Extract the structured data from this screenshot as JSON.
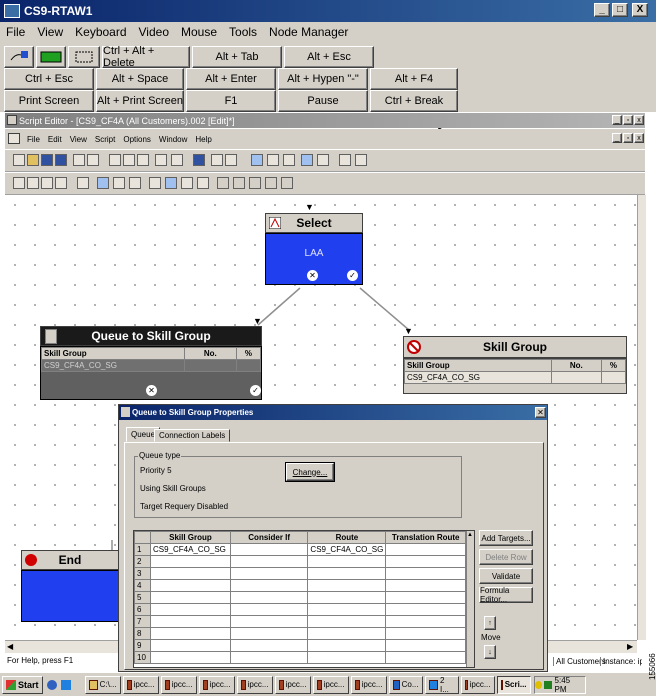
{
  "outer_window": {
    "title": "CS9-RTAW1",
    "menu": [
      "File",
      "View",
      "Keyboard",
      "Video",
      "Mouse",
      "Tools",
      "Node Manager"
    ],
    "controls": [
      "_",
      "□",
      "X"
    ]
  },
  "macro_buttons": {
    "row1": [
      "Ctrl + Alt + Delete",
      "Alt + Tab",
      "Alt + Esc"
    ],
    "row2": [
      "Ctrl + Esc",
      "Alt + Space",
      "Alt + Enter",
      "Alt + Hypen \"-\"",
      "Alt + F4"
    ],
    "row3": [
      "Print Screen",
      "Alt + Print Screen",
      "F1",
      "Pause",
      "Ctrl + Break"
    ]
  },
  "script_editor": {
    "title": "Script Editor - [CS9_CF4A (All Customers).002 [Edit]*]",
    "menu": [
      "File",
      "Edit",
      "View",
      "Script",
      "Options",
      "Window",
      "Help"
    ]
  },
  "nodes": {
    "select": {
      "title": "Select",
      "body": "LAA"
    },
    "queue": {
      "title": "Queue to Skill Group",
      "cols": [
        "Skill Group",
        "No.",
        "%"
      ],
      "row": "CS9_CF4A_CO_SG"
    },
    "skill": {
      "title": "Skill Group",
      "cols": [
        "Skill Group",
        "No.",
        "%"
      ],
      "row": "CS9_CF4A_CO_SG"
    },
    "end": {
      "title": "End"
    }
  },
  "dialog": {
    "title": "Queue to Skill Group Properties",
    "tabs": [
      "Queue",
      "Connection Labels"
    ],
    "group_label": "Queue type",
    "priority": "Priority 5",
    "using": "Using Skill Groups",
    "target": "Target Requery Disabled",
    "change_button": "Change...",
    "table_headers": [
      "Skill Group",
      "Consider If",
      "Route",
      "Translation Route"
    ],
    "row1_skill": "CS9_CF4A_CO_SG",
    "row1_route": "CS9_CF4A_CO_SG",
    "row_numbers": [
      "1",
      "2",
      "3",
      "4",
      "5",
      "6",
      "7",
      "8",
      "9",
      "10"
    ],
    "buttons": [
      "Add Targets...",
      "Delete Row",
      "Validate",
      "Formula Editor..."
    ],
    "move_label": "Move"
  },
  "status_bar": {
    "help": "For Help, press F1",
    "customers": "All Customers",
    "instance": "Instance: ipc"
  },
  "taskbar": {
    "start": "Start",
    "items": [
      "C:\\...",
      "ipcc...",
      "ipcc...",
      "ipcc...",
      "ipcc...",
      "ipcc...",
      "ipcc...",
      "ipcc...",
      "Co...",
      "2 I...",
      "ipcc...",
      "Scri..."
    ],
    "clock": "5:45 PM"
  },
  "figure_id": "155066"
}
